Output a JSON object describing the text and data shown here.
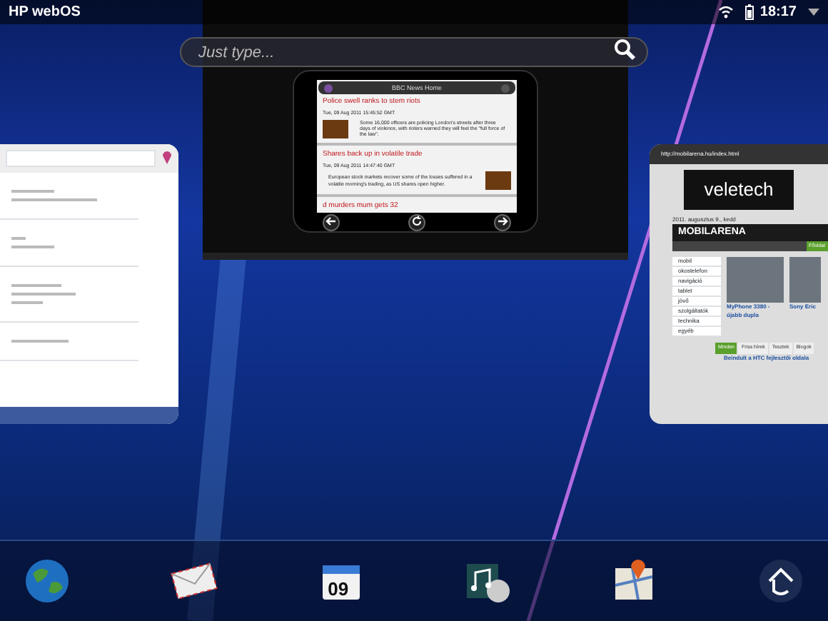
{
  "status_bar": {
    "title": "HP webOS",
    "time": "18:17"
  },
  "search": {
    "placeholder": "Just type..."
  },
  "news_card": {
    "title": "BBC News Home",
    "stories": [
      {
        "headline": "Police swell ranks to stem riots",
        "date": "Tue, 09 Aug 2011 15:45:52 GMT",
        "summary": "Some 16,000 officers are policing London's streets after three days of violence, with rioters warned they will feel the \"full force of the law\"."
      },
      {
        "headline": "Shares back up in volatile trade",
        "date": "Tue, 09 Aug 2011 14:47:40 GMT",
        "summary": "European stock markets recover some of the losses suffered in a volatile morning's trading, as US shares open higher."
      },
      {
        "headline": "d murders mum gets 32"
      }
    ]
  },
  "web_card": {
    "url": "http://mobilarena.hu/index.html",
    "banner": "veletech",
    "date": "2011. augusztus 9., kedd",
    "site": "MOBILARENA",
    "tabs": [
      {
        "label": "Főoldal",
        "selected": true
      }
    ],
    "menu": [
      "mobil",
      "okostelefon",
      "navigáció",
      "tablet",
      "jövő",
      "szolgáltatók",
      "technika",
      "egyéb"
    ],
    "articles": [
      "MyPhone 3380 - újabb dupla",
      "Sony Eric"
    ],
    "news_tabs": [
      {
        "label": "Minden",
        "selected": true
      },
      {
        "label": "Friss hírek",
        "selected": false
      },
      {
        "label": "Tesztek",
        "selected": false
      },
      {
        "label": "Blogok",
        "selected": false
      }
    ],
    "headline": "Beindult a HTC fejlesztői oldala"
  },
  "dock": [
    {
      "kind": "globe"
    },
    {
      "kind": "mail"
    },
    {
      "kind": "calendar",
      "text": "09"
    },
    {
      "kind": "music"
    },
    {
      "kind": "maps"
    },
    {
      "kind": "launcher"
    }
  ]
}
